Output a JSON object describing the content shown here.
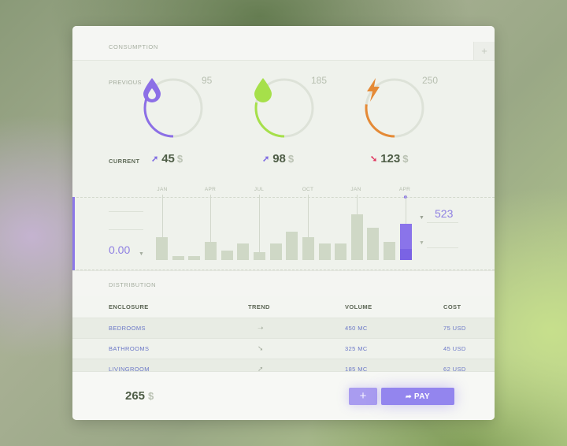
{
  "header": {
    "title": "CONSUMPTION",
    "add_label": "+"
  },
  "labels": {
    "previous": "PREVIOUS",
    "current": "CURRENT"
  },
  "gauges": [
    {
      "name": "water",
      "icon": "water-drop-icon",
      "color": "#8c6fe6",
      "previous": "95",
      "current": "45",
      "unit": "$",
      "trend": "up",
      "arrow": "➚",
      "arrow_color": "#7f6be2",
      "fill_fraction": 0.3
    },
    {
      "name": "gas",
      "icon": "green-drop-icon",
      "color": "#a6e04a",
      "previous": "185",
      "current": "98",
      "unit": "$",
      "trend": "up",
      "arrow": "➚",
      "arrow_color": "#7f6be2",
      "fill_fraction": 0.28
    },
    {
      "name": "electricity",
      "icon": "lightning-bolt-icon",
      "color": "#e58a36",
      "previous": "250",
      "current": "123",
      "unit": "$",
      "trend": "down",
      "arrow": "➘",
      "arrow_color": "#e0355e",
      "fill_fraction": 0.27
    }
  ],
  "chart": {
    "months": [
      "JAN",
      "APR",
      "JUL",
      "OCT",
      "JAN",
      "APR"
    ],
    "left_value": "0.00",
    "right_value": "523"
  },
  "chart_data": {
    "type": "bar",
    "x_tick_labels": [
      "JAN",
      "APR",
      "JUL",
      "OCT",
      "JAN",
      "APR"
    ],
    "values": [
      28,
      5,
      5,
      22,
      12,
      20,
      10,
      20,
      35,
      28,
      20,
      20,
      56,
      40,
      22,
      45
    ],
    "selected_index": 15,
    "ylim": [
      0,
      70
    ]
  },
  "distribution": {
    "title": "DISTRIBUTION"
  },
  "table": {
    "headers": {
      "enclosure": "ENCLOSURE",
      "trend": "TREND",
      "volume": "VOLUME",
      "cost": "COST"
    },
    "rows": [
      {
        "enclosure": "BEDROOMS",
        "trend": "➝",
        "volume": "450 MC",
        "cost": "75 USD"
      },
      {
        "enclosure": "BATHROOMS",
        "trend": "➘",
        "volume": "325 MC",
        "cost": "45 USD"
      },
      {
        "enclosure": "LIVINGROOM",
        "trend": "➚",
        "volume": "185 MC",
        "cost": "62 USD"
      }
    ]
  },
  "footer": {
    "total": "265",
    "unit": "$",
    "add_label": "+",
    "pay_label": "PAY",
    "pay_icon": "➦"
  }
}
